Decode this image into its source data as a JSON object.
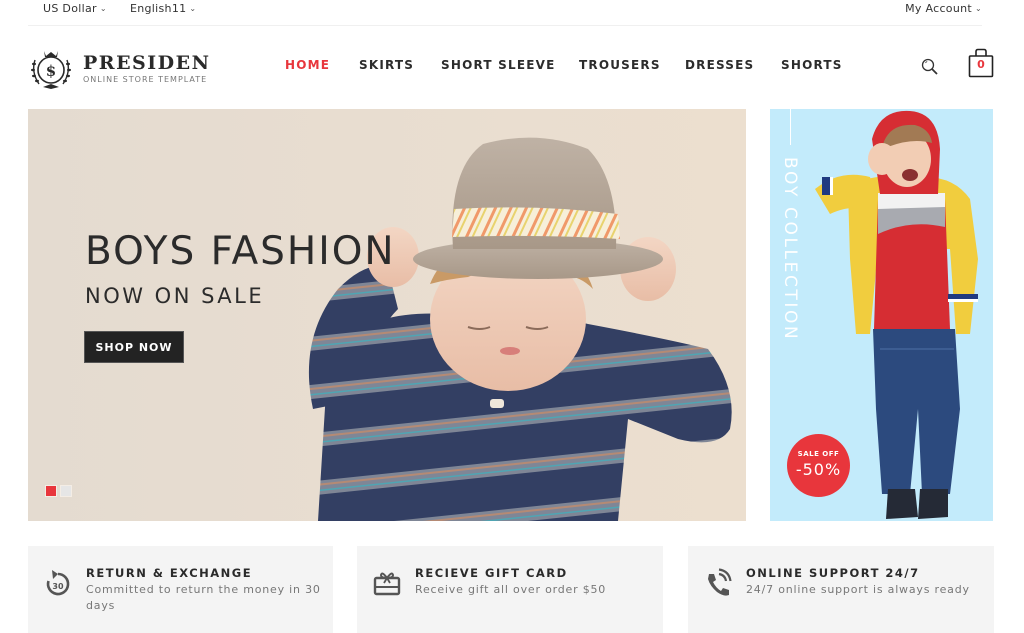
{
  "topbar": {
    "currency": "US Dollar",
    "language": "English11",
    "account": "My Account"
  },
  "logo": {
    "name": "PRESIDEN",
    "tagline": "ONLINE STORE TEMPLATE"
  },
  "nav": {
    "items": [
      {
        "label": "HOME",
        "active": true
      },
      {
        "label": "SKIRTS",
        "active": false
      },
      {
        "label": "SHORT SLEEVE",
        "active": false
      },
      {
        "label": "TROUSERS",
        "active": false
      },
      {
        "label": "DRESSES",
        "active": false
      },
      {
        "label": "SHORTS",
        "active": false
      }
    ]
  },
  "header": {
    "search_icon": "search-icon",
    "cart_icon": "shopping-bag-icon",
    "cart_count": "0"
  },
  "hero": {
    "title": "BOYS FASHION",
    "subtitle": "NOW ON SALE",
    "button": "SHOP NOW",
    "slides": 2,
    "active_slide": 1
  },
  "side_banner": {
    "label": "BOY COLLECTION",
    "badge_top": "SALE OFF",
    "badge_value": "-50%"
  },
  "features": [
    {
      "icon": "return-30-icon",
      "title": "RETURN & EXCHANGE",
      "desc": "Committed to return the money in 30 days"
    },
    {
      "icon": "gift-card-icon",
      "title": "RECIEVE GIFT CARD",
      "desc": "Receive gift all over order $50"
    },
    {
      "icon": "phone-support-icon",
      "title": "ONLINE SUPPORT 24/7",
      "desc": "24/7 online support is always ready"
    }
  ],
  "colors": {
    "accent": "#e8363c",
    "dark": "#232323",
    "side_banner_bg": "#c3ebfb",
    "feature_bg": "#f4f4f4"
  }
}
